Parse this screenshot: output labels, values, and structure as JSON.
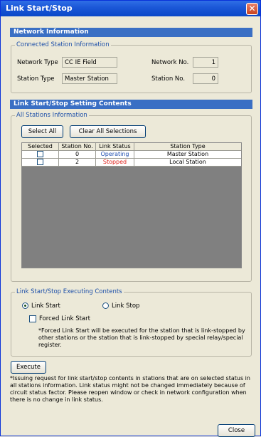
{
  "window": {
    "title": "Link Start/Stop",
    "close_glyph": "✕"
  },
  "network_info": {
    "header": "Network Information",
    "group_title": "Connected Station Information",
    "network_type_label": "Network Type",
    "network_type_value": "CC IE Field",
    "network_no_label": "Network No.",
    "network_no_value": "1",
    "station_type_label": "Station Type",
    "station_type_value": "Master Station",
    "station_no_label": "Station No.",
    "station_no_value": "0"
  },
  "setting": {
    "header": "Link Start/Stop Setting Contents",
    "group_title": "All Stations Information",
    "select_all_label": "Select All",
    "clear_all_label": "Clear All Selections",
    "columns": [
      "Selected Status",
      "Station No.",
      "Link Status",
      "Station Type"
    ],
    "rows": [
      {
        "station_no": "0",
        "link_status": "Operating",
        "status_color": "#1f4fb0",
        "station_type": "Master Station"
      },
      {
        "station_no": "2",
        "link_status": "Stopped",
        "status_color": "#e0201a",
        "station_type": "Local Station"
      }
    ]
  },
  "executing": {
    "group_title": "Link Start/Stop Executing Contents",
    "link_start_label": "Link Start",
    "link_stop_label": "Link Stop",
    "selected_option": "Link Start",
    "forced_label": "Forced Link Start",
    "forced_note": "*Forced Link Start will be executed for the station that is link-stopped by other stations or the station that is link-stopped by special relay/special register."
  },
  "execute_label": "Execute",
  "footer_note": "*Issuing request for link start/stop contents in stations that are on selected status in all stations information. Link status might not be changed immediately because of circuit status factor. Please reopen window or check in network configuration when there is no change in link status.",
  "close_label": "Close"
}
